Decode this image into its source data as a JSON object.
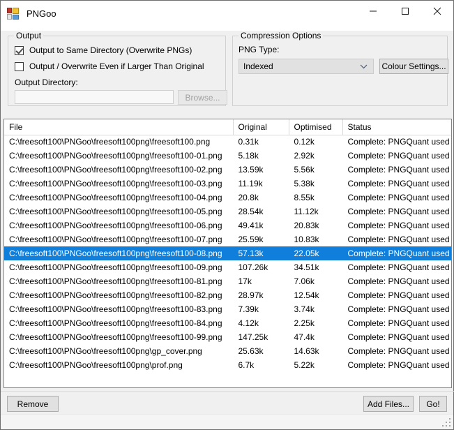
{
  "window": {
    "title": "PNGoo",
    "icon": "app-icon",
    "controls": [
      {
        "name": "minimize",
        "glyph": "minimize-icon"
      },
      {
        "name": "maximize",
        "glyph": "maximize-icon"
      },
      {
        "name": "close",
        "glyph": "close-icon"
      }
    ]
  },
  "output_group": {
    "title": "Output",
    "checkbox_same_dir": {
      "label": "Output to Same Directory (Overwrite PNGs)",
      "checked": true
    },
    "checkbox_overwrite_larger": {
      "label": "Output / Overwrite Even if Larger Than Original",
      "checked": false
    },
    "directory_label": "Output Directory:",
    "directory_value": "",
    "directory_placeholder": "",
    "browse_button": "Browse..."
  },
  "compression_group": {
    "title": "Compression Options",
    "png_type_label": "PNG Type:",
    "png_type_value": "Indexed",
    "png_type_options": [
      "Indexed"
    ],
    "colour_settings_button": "Colour Settings..."
  },
  "list": {
    "columns": [
      "File",
      "Original",
      "Optimised",
      "Status"
    ],
    "selected_index": 8,
    "rows": [
      {
        "file": "C:\\freesoft100\\PNGoo\\freesoft100png\\freesoft100.png",
        "original": "0.31k",
        "optimised": "0.12k",
        "status": "Complete: PNGQuant used"
      },
      {
        "file": "C:\\freesoft100\\PNGoo\\freesoft100png\\freesoft100-01.png",
        "original": "5.18k",
        "optimised": "2.92k",
        "status": "Complete: PNGQuant used"
      },
      {
        "file": "C:\\freesoft100\\PNGoo\\freesoft100png\\freesoft100-02.png",
        "original": "13.59k",
        "optimised": "5.56k",
        "status": "Complete: PNGQuant used"
      },
      {
        "file": "C:\\freesoft100\\PNGoo\\freesoft100png\\freesoft100-03.png",
        "original": "11.19k",
        "optimised": "5.38k",
        "status": "Complete: PNGQuant used"
      },
      {
        "file": "C:\\freesoft100\\PNGoo\\freesoft100png\\freesoft100-04.png",
        "original": "20.8k",
        "optimised": "8.55k",
        "status": "Complete: PNGQuant used"
      },
      {
        "file": "C:\\freesoft100\\PNGoo\\freesoft100png\\freesoft100-05.png",
        "original": "28.54k",
        "optimised": "11.12k",
        "status": "Complete: PNGQuant used"
      },
      {
        "file": "C:\\freesoft100\\PNGoo\\freesoft100png\\freesoft100-06.png",
        "original": "49.41k",
        "optimised": "20.83k",
        "status": "Complete: PNGQuant used"
      },
      {
        "file": "C:\\freesoft100\\PNGoo\\freesoft100png\\freesoft100-07.png",
        "original": "25.59k",
        "optimised": "10.83k",
        "status": "Complete: PNGQuant used"
      },
      {
        "file": "C:\\freesoft100\\PNGoo\\freesoft100png\\freesoft100-08.png",
        "original": "57.13k",
        "optimised": "22.05k",
        "status": "Complete: PNGQuant used"
      },
      {
        "file": "C:\\freesoft100\\PNGoo\\freesoft100png\\freesoft100-09.png",
        "original": "107.26k",
        "optimised": "34.51k",
        "status": "Complete: PNGQuant used"
      },
      {
        "file": "C:\\freesoft100\\PNGoo\\freesoft100png\\freesoft100-81.png",
        "original": "17k",
        "optimised": "7.06k",
        "status": "Complete: PNGQuant used"
      },
      {
        "file": "C:\\freesoft100\\PNGoo\\freesoft100png\\freesoft100-82.png",
        "original": "28.97k",
        "optimised": "12.54k",
        "status": "Complete: PNGQuant used"
      },
      {
        "file": "C:\\freesoft100\\PNGoo\\freesoft100png\\freesoft100-83.png",
        "original": "7.39k",
        "optimised": "3.74k",
        "status": "Complete: PNGQuant used"
      },
      {
        "file": "C:\\freesoft100\\PNGoo\\freesoft100png\\freesoft100-84.png",
        "original": "4.12k",
        "optimised": "2.25k",
        "status": "Complete: PNGQuant used"
      },
      {
        "file": "C:\\freesoft100\\PNGoo\\freesoft100png\\freesoft100-99.png",
        "original": "147.25k",
        "optimised": "47.4k",
        "status": "Complete: PNGQuant used"
      },
      {
        "file": "C:\\freesoft100\\PNGoo\\freesoft100png\\gp_cover.png",
        "original": "25.63k",
        "optimised": "14.63k",
        "status": "Complete: PNGQuant used"
      },
      {
        "file": "C:\\freesoft100\\PNGoo\\freesoft100png\\prof.png",
        "original": "6.7k",
        "optimised": "5.22k",
        "status": "Complete: PNGQuant used"
      }
    ]
  },
  "bottom_bar": {
    "remove_button": "Remove",
    "add_files_button": "Add Files...",
    "go_button": "Go!"
  },
  "colors": {
    "selection": "#0f7fdb",
    "window_bg": "#f0f0f0",
    "list_bg": "#ffffff"
  }
}
